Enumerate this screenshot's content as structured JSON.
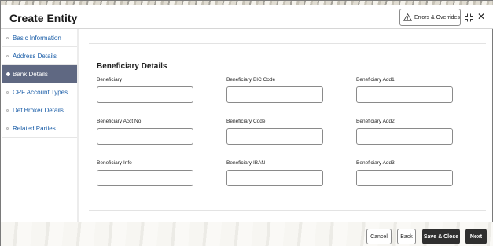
{
  "header": {
    "title": "Create Entity",
    "errors_label": "Errors & Overrides",
    "warning_icon": "warning-icon",
    "expand_icon": "expand-icon",
    "close_glyph": "✕"
  },
  "sidebar": {
    "items": [
      {
        "label": "Basic Information",
        "active": false
      },
      {
        "label": "Address Details",
        "active": false
      },
      {
        "label": "Bank Details",
        "active": true
      },
      {
        "label": "CPF Account Types",
        "active": false
      },
      {
        "label": "Def Broker Details",
        "active": false
      },
      {
        "label": "Related Parties",
        "active": false
      }
    ]
  },
  "main": {
    "section_title": "Beneficiary Details",
    "fields": [
      {
        "label": "Beneficiary",
        "value": ""
      },
      {
        "label": "Beneficiary BIC Code",
        "value": ""
      },
      {
        "label": "Beneficiary Add1",
        "value": ""
      },
      {
        "label": "Beneficiary Acct No",
        "value": ""
      },
      {
        "label": "Beneficiary Code",
        "value": ""
      },
      {
        "label": "Beneficiary Add2",
        "value": ""
      },
      {
        "label": "Beneficiary Info",
        "value": ""
      },
      {
        "label": "Beneficiary IBAN",
        "value": ""
      },
      {
        "label": "Beneficiary Add3",
        "value": ""
      }
    ]
  },
  "footer": {
    "cancel_label": "Cancel",
    "back_label": "Back",
    "save_close_label": "Save & Close",
    "next_label": "Next"
  },
  "colors": {
    "active_nav": "#5f6882",
    "link": "#1b5ea8",
    "primary_button": "#2f2f2f"
  }
}
